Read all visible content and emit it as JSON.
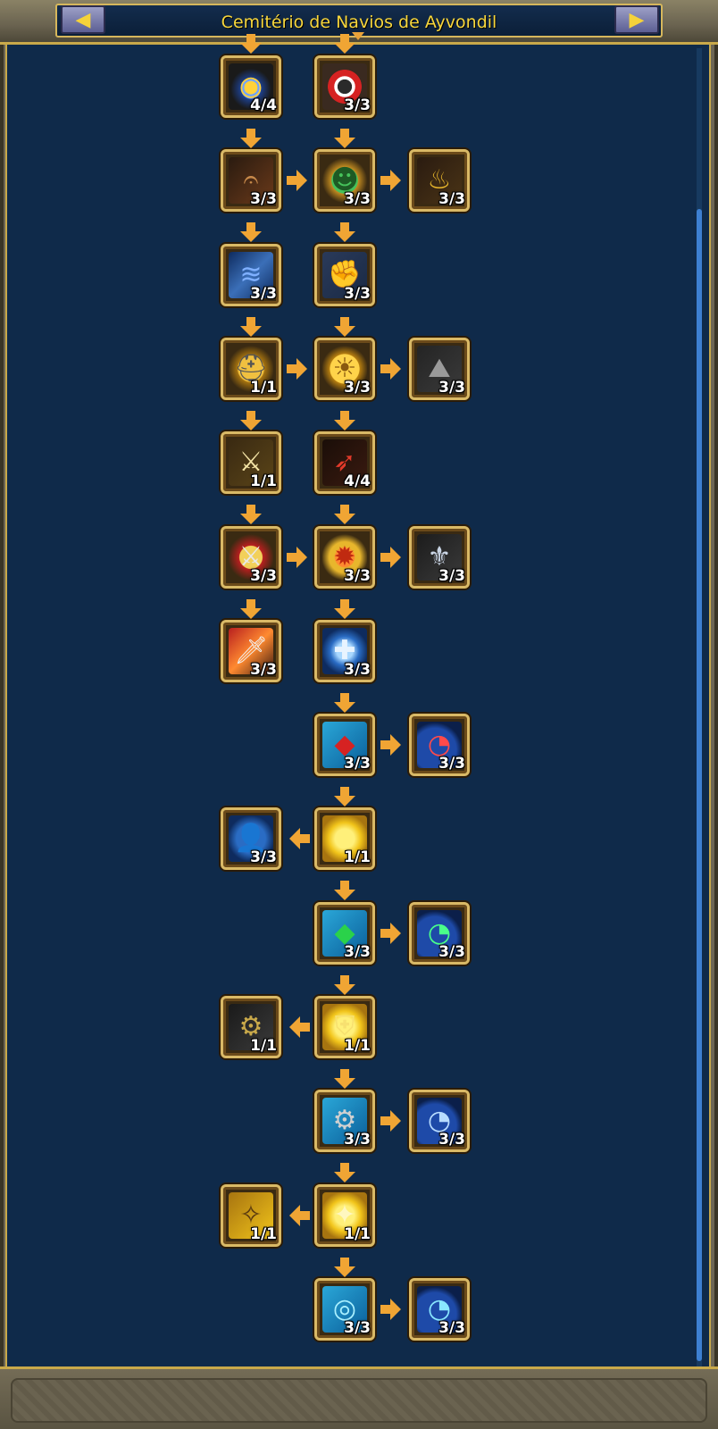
{
  "header": {
    "title": "Cemitério de Navios de Ayvondil",
    "prev_label": "◀",
    "next_label": "▶"
  },
  "skills": [
    {
      "id": "r1c1",
      "level": "4/4",
      "icon": "blue-orb-ring-icon"
    },
    {
      "id": "r1c2",
      "level": "3/3",
      "icon": "life-ring-icon"
    },
    {
      "id": "r2c1",
      "level": "3/3",
      "icon": "brown-horn-icon"
    },
    {
      "id": "r2c2",
      "level": "3/3",
      "icon": "green-mask-icon"
    },
    {
      "id": "r2c3",
      "level": "3/3",
      "icon": "golden-lamp-icon"
    },
    {
      "id": "r3c1",
      "level": "3/3",
      "icon": "blue-wave-icon"
    },
    {
      "id": "r3c2",
      "level": "3/3",
      "icon": "punching-fist-icon"
    },
    {
      "id": "r4c1",
      "level": "1/1",
      "icon": "armored-helm-icon"
    },
    {
      "id": "r4c2",
      "level": "3/3",
      "icon": "golden-emblem-icon"
    },
    {
      "id": "r4c3",
      "level": "3/3",
      "icon": "stone-shell-icon"
    },
    {
      "id": "r5c1",
      "level": "1/1",
      "icon": "golden-sword-icon"
    },
    {
      "id": "r5c2",
      "level": "4/4",
      "icon": "red-bow-icon"
    },
    {
      "id": "r6c1",
      "level": "3/3",
      "icon": "crossed-blades-icon"
    },
    {
      "id": "r6c2",
      "level": "3/3",
      "icon": "fire-medallion-icon"
    },
    {
      "id": "r6c3",
      "level": "3/3",
      "icon": "silver-armor-icon"
    },
    {
      "id": "r7c1",
      "level": "3/3",
      "icon": "flaming-sword-icon"
    },
    {
      "id": "r7c2",
      "level": "3/3",
      "icon": "blue-sword-orb-icon"
    },
    {
      "id": "r8c2",
      "level": "3/3",
      "icon": "red-crystal-scroll-icon"
    },
    {
      "id": "r8c3",
      "level": "3/3",
      "icon": "red-gauge-icon"
    },
    {
      "id": "r9c1",
      "level": "3/3",
      "icon": "blue-silhouette-icon"
    },
    {
      "id": "r9c2",
      "level": "1/1",
      "icon": "golden-bell-icon"
    },
    {
      "id": "r10c2",
      "level": "3/3",
      "icon": "green-crystal-scroll-icon"
    },
    {
      "id": "r10c3",
      "level": "3/3",
      "icon": "green-gauge-icon"
    },
    {
      "id": "r11c1",
      "level": "1/1",
      "icon": "dark-machine-icon"
    },
    {
      "id": "r11c2",
      "level": "1/1",
      "icon": "golden-shield-icon"
    },
    {
      "id": "r12c2",
      "level": "3/3",
      "icon": "gear-scroll-icon"
    },
    {
      "id": "r12c3",
      "level": "3/3",
      "icon": "blue-gauge-icon"
    },
    {
      "id": "r13c1",
      "level": "1/1",
      "icon": "golden-compass-icon"
    },
    {
      "id": "r13c2",
      "level": "1/1",
      "icon": "golden-star-icon"
    },
    {
      "id": "r14c2",
      "level": "3/3",
      "icon": "cyan-ring-scroll-icon"
    },
    {
      "id": "r14c3",
      "level": "3/3",
      "icon": "cyan-gauge-icon"
    }
  ],
  "colors": {
    "background": "#0f2a4a",
    "gold_border": "#d9b966",
    "arrow": "#f0a534",
    "title_text": "#f7d63c"
  }
}
